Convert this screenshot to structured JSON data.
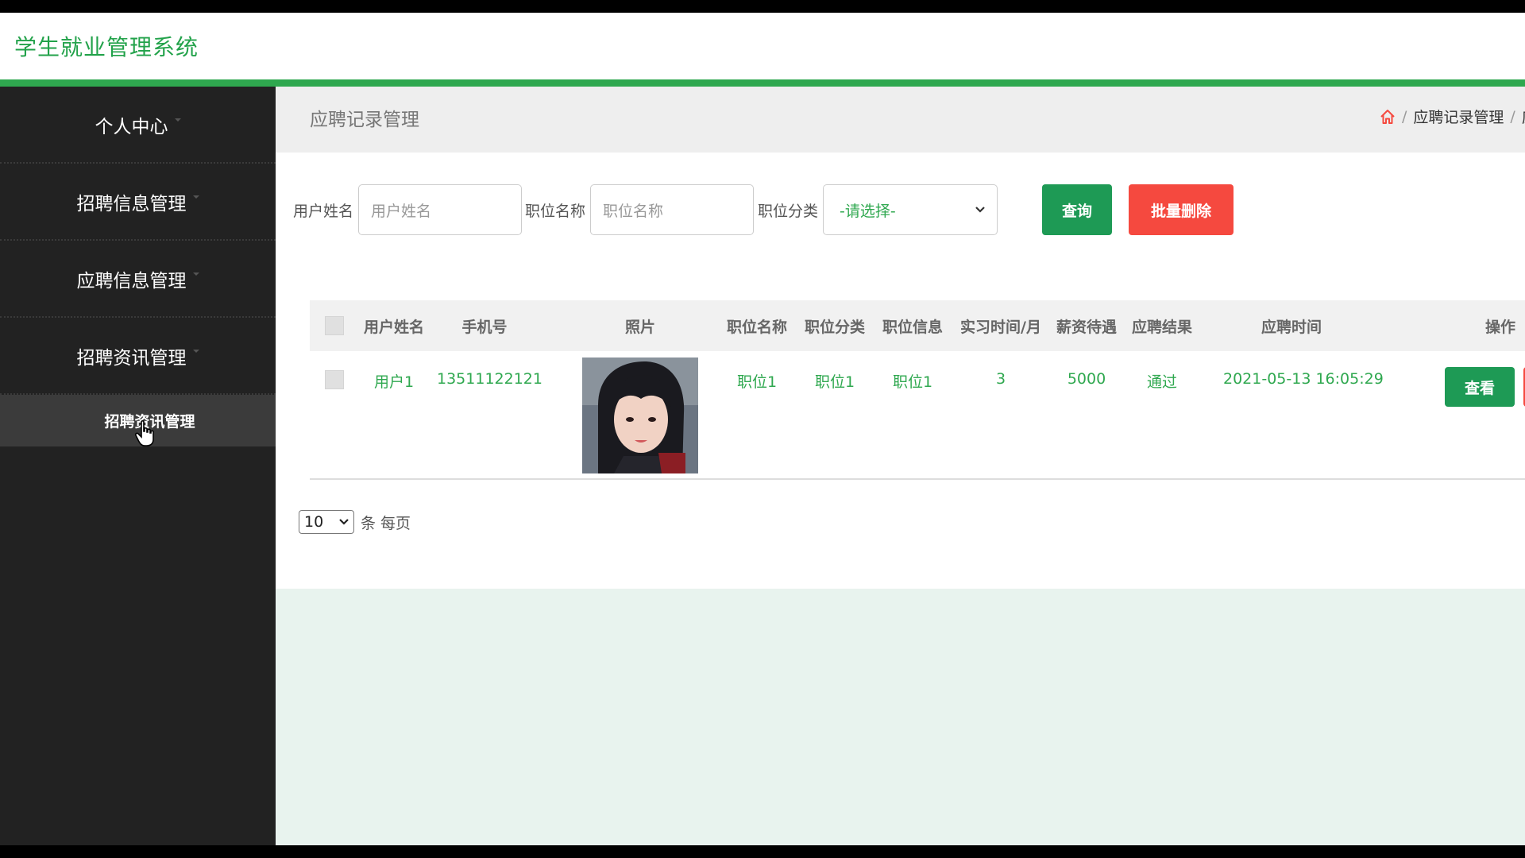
{
  "app": {
    "title": "学生就业管理系统"
  },
  "sidebar": {
    "items": [
      {
        "label": "个人中心"
      },
      {
        "label": "招聘信息管理"
      },
      {
        "label": "应聘信息管理"
      },
      {
        "label": "招聘资讯管理"
      }
    ],
    "active_sub": {
      "label": "招聘资讯管理"
    }
  },
  "page": {
    "title": "应聘记录管理",
    "breadcrumb": {
      "current": "应聘记录管理",
      "separator": "/",
      "trailing": "应"
    }
  },
  "filters": {
    "username_label": "用户姓名",
    "username_placeholder": "用户姓名",
    "position_label": "职位名称",
    "position_placeholder": "职位名称",
    "category_label": "职位分类",
    "category_value": "-请选择-",
    "query_label": "查询",
    "batch_delete_label": "批量删除"
  },
  "table": {
    "headers": [
      "用户姓名",
      "手机号",
      "照片",
      "职位名称",
      "职位分类",
      "职位信息",
      "实习时间/月",
      "薪资待遇",
      "应聘结果",
      "应聘时间",
      "操作"
    ],
    "rows": [
      {
        "username": "用户1",
        "phone": "13511122121",
        "position_name": "职位1",
        "position_category": "职位1",
        "position_info": "职位1",
        "internship_months": "3",
        "salary": "5000",
        "result": "通过",
        "apply_time": "2021-05-13 16:05:29",
        "view_label": "查看"
      }
    ]
  },
  "pager": {
    "page_size": "10",
    "suffix": "条 每页"
  },
  "colors": {
    "brand_green": "#2fa84f",
    "danger_red": "#f5493f",
    "sidebar_bg": "#222222"
  }
}
